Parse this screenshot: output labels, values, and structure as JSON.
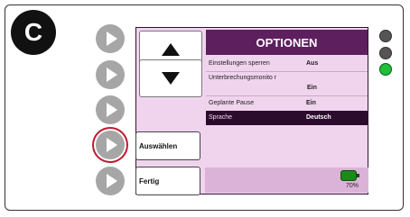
{
  "badge": {
    "letter": "C"
  },
  "screen": {
    "title": "OPTIONEN",
    "menu": [
      {
        "label": "Einstellungen sperren",
        "value": "Aus"
      },
      {
        "label": "Unterbrechungsmonito r",
        "value": "Ein"
      },
      {
        "label": "Geplante Pause",
        "value": "Ein"
      },
      {
        "label": "Sprache",
        "value": "Deutsch",
        "selected": true
      }
    ],
    "select_label": "Auswählen",
    "done_label": "Fertig",
    "battery_percent": "70%"
  },
  "indicators": [
    "off",
    "off",
    "on"
  ],
  "colors": {
    "title_bar": "#5e1f5e",
    "screen_bg": "#f0d4ee",
    "highlight_row": "#2c0c2c",
    "selected_ring": "#c0182c",
    "led_on": "#1fbf3a",
    "battery": "#1a8a1a"
  }
}
